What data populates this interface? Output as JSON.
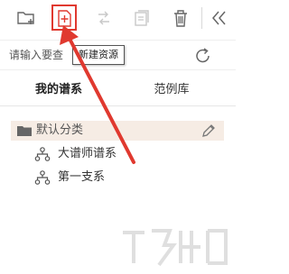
{
  "toolbar": {
    "buttons": [
      {
        "name": "new-folder-icon",
        "enabled": true
      },
      {
        "name": "new-resource-icon",
        "enabled": true,
        "highlighted": true
      },
      {
        "name": "move-icon",
        "enabled": false
      },
      {
        "name": "copy-icon",
        "enabled": false
      },
      {
        "name": "delete-icon",
        "enabled": true
      },
      {
        "name": "collapse-panel-icon",
        "enabled": true
      }
    ]
  },
  "tooltip": {
    "text": "新建资源"
  },
  "search": {
    "placeholder": "请输入要查"
  },
  "tabs": [
    {
      "label": "我的谱系",
      "active": true
    },
    {
      "label": "范例库",
      "active": false
    }
  ],
  "tree": {
    "folder": {
      "label": "默认分类"
    },
    "children": [
      {
        "label": "大谱师谱系"
      },
      {
        "label": "第一支系"
      }
    ]
  },
  "colors": {
    "annotation_red": "#e0392f",
    "selected_row_bg": "#f6ece4",
    "icon_gray": "#666666",
    "icon_disabled": "#c8c8c8"
  }
}
